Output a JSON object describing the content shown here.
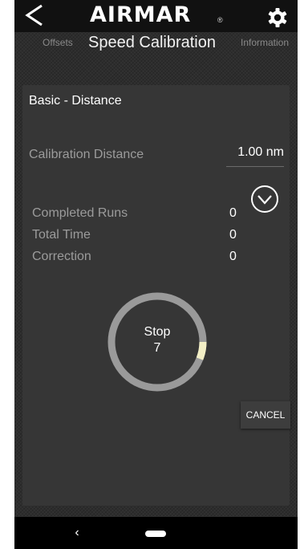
{
  "header": {
    "logo_text": "AIRMAR",
    "logo_mark": "®",
    "back_icon": "chevron-left-icon",
    "settings_icon": "gear-icon"
  },
  "tabs": {
    "left": "Offsets",
    "active": "Speed Calibration",
    "right": "Information"
  },
  "card": {
    "title": "Basic - Distance",
    "calibration_distance_label": "Calibration Distance",
    "calibration_distance_value": "1.00 nm",
    "expand_icon": "chevron-down-circle-icon",
    "stats": [
      {
        "label": "Completed Runs",
        "value": "0"
      },
      {
        "label": "Total Time",
        "value": "0"
      },
      {
        "label": "Correction",
        "value": "0"
      }
    ],
    "stop_label": "Stop",
    "stop_count": "7",
    "ring_progress": 0.12,
    "cancel_label": "CANCEL"
  },
  "colors": {
    "ring_track": "#9a9a9a",
    "ring_progress": "#f3efc6"
  },
  "navbar": {
    "back_glyph": "‹"
  }
}
